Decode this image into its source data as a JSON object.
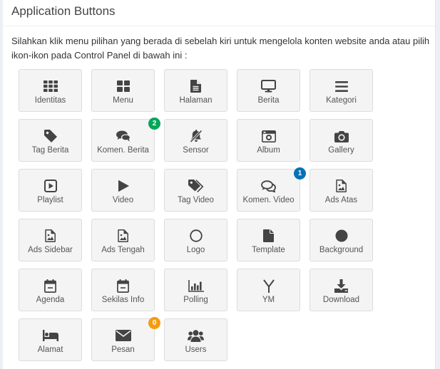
{
  "page": {
    "title": "Application Buttons",
    "intro": "Silahkan klik menu pilihan yang berada di sebelah kiri untuk mengelola konten website anda atau pilih ikon-ikon pada Control Panel di bawah ini :"
  },
  "colors": {
    "badge_green": "#00a65a",
    "badge_blue": "#0073b7",
    "badge_orange": "#f39c12"
  },
  "buttons": [
    {
      "label": "Identitas",
      "icon": "grid-icon"
    },
    {
      "label": "Menu",
      "icon": "th-large-icon"
    },
    {
      "label": "Halaman",
      "icon": "file-text-icon"
    },
    {
      "label": "Berita",
      "icon": "monitor-icon"
    },
    {
      "label": "Kategori",
      "icon": "bars-icon"
    },
    {
      "label": "Tag Berita",
      "icon": "tag-icon"
    },
    {
      "label": "Komen. Berita",
      "icon": "comments-icon",
      "badge": "2",
      "badge_color": "#00a65a"
    },
    {
      "label": "Sensor",
      "icon": "bell-slash-icon"
    },
    {
      "label": "Album",
      "icon": "camera-retro-icon"
    },
    {
      "label": "Gallery",
      "icon": "camera-icon"
    },
    {
      "label": "Playlist",
      "icon": "play-square-icon"
    },
    {
      "label": "Video",
      "icon": "play-icon"
    },
    {
      "label": "Tag Video",
      "icon": "tags-icon"
    },
    {
      "label": "Komen. Video",
      "icon": "comments-outline-icon",
      "badge": "1",
      "badge_color": "#0073b7"
    },
    {
      "label": "Ads Atas",
      "icon": "image-file-icon"
    },
    {
      "label": "Ads Sidebar",
      "icon": "image-file-icon"
    },
    {
      "label": "Ads Tengah",
      "icon": "image-file-icon"
    },
    {
      "label": "Logo",
      "icon": "circle-outline-icon"
    },
    {
      "label": "Template",
      "icon": "file-icon"
    },
    {
      "label": "Background",
      "icon": "circle-icon"
    },
    {
      "label": "Agenda",
      "icon": "calendar-icon"
    },
    {
      "label": "Sekilas Info",
      "icon": "calendar-icon"
    },
    {
      "label": "Polling",
      "icon": "bar-chart-icon"
    },
    {
      "label": "YM",
      "icon": "yahoo-icon"
    },
    {
      "label": "Download",
      "icon": "download-icon"
    },
    {
      "label": "Alamat",
      "icon": "bed-icon"
    },
    {
      "label": "Pesan",
      "icon": "envelope-icon",
      "badge": "0",
      "badge_color": "#f39c12"
    },
    {
      "label": "Users",
      "icon": "users-icon"
    }
  ]
}
